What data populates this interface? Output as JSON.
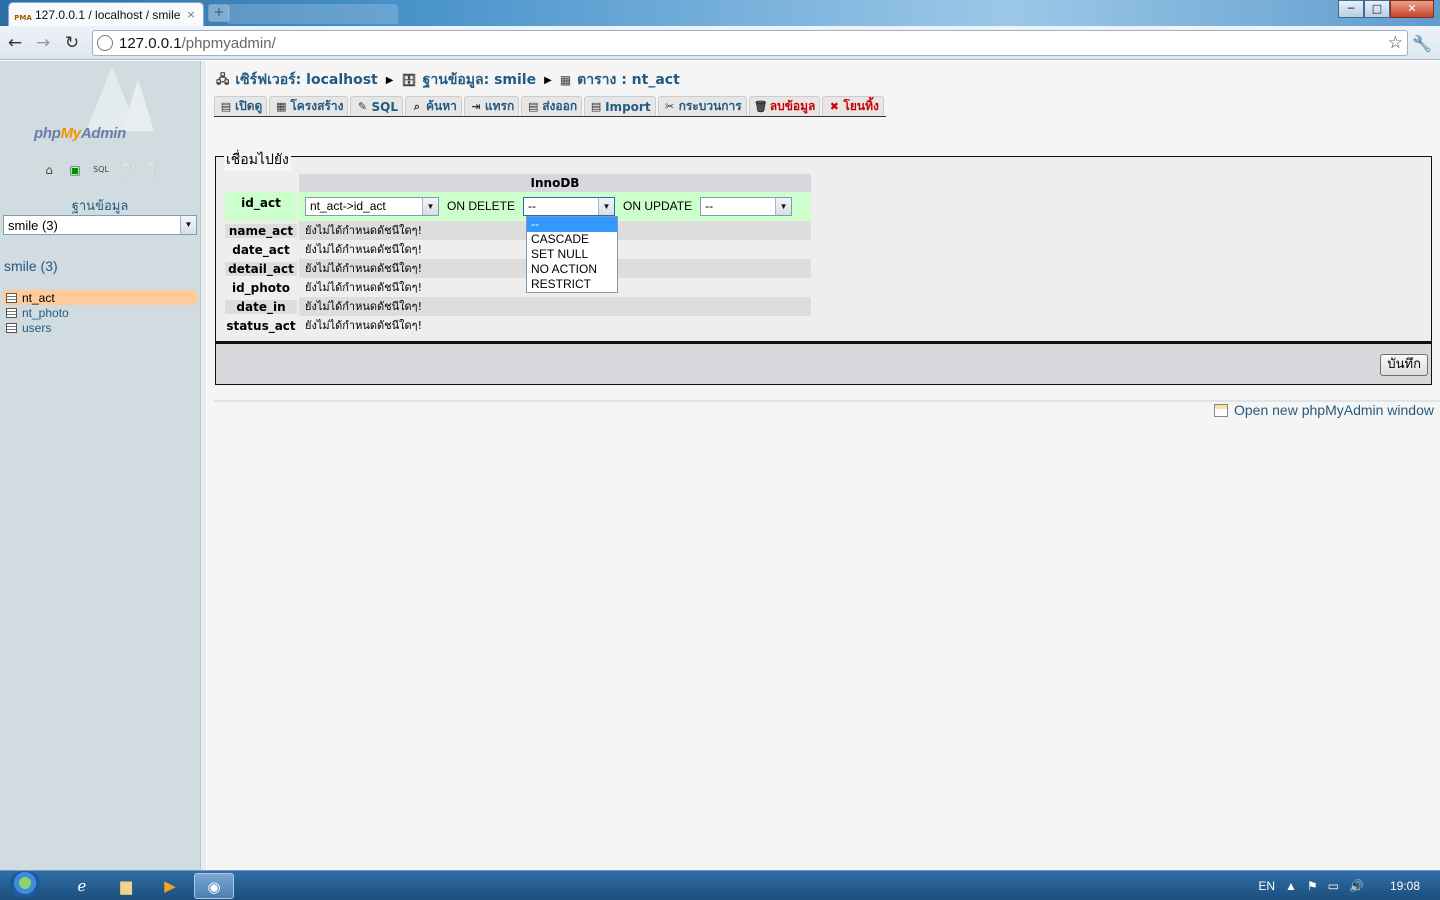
{
  "browser": {
    "tab_title": "127.0.0.1 / localhost / smile",
    "tab_favicon_text": "PMA",
    "url_host": "127.0.0.1",
    "url_path": "/phpmyadmin/"
  },
  "window_controls": {
    "minimize": "─",
    "maximize": "□",
    "close": "✕"
  },
  "sidebar": {
    "logo_php": "php",
    "logo_my": "My",
    "logo_admin": "Admin",
    "db_label": "ฐานข้อมูล",
    "db_select_value": "smile (3)",
    "db_heading": "smile (3)",
    "tables": [
      {
        "name": "nt_act",
        "active": true
      },
      {
        "name": "nt_photo",
        "active": false
      },
      {
        "name": "users",
        "active": false
      }
    ]
  },
  "breadcrumb": {
    "server": "เซิร์ฟเวอร์: localhost",
    "database": "ฐานข้อมูล: smile",
    "table": "ตาราง : nt_act"
  },
  "menu_tabs": [
    {
      "label": "เปิดดู",
      "icon": "browse-icon",
      "danger": false
    },
    {
      "label": "โครงสร้าง",
      "icon": "structure-icon",
      "danger": false
    },
    {
      "label": "SQL",
      "icon": "sql-icon",
      "danger": false
    },
    {
      "label": "ค้นหา",
      "icon": "search-icon",
      "danger": false
    },
    {
      "label": "แทรก",
      "icon": "insert-icon",
      "danger": false
    },
    {
      "label": "ส่งออก",
      "icon": "export-icon",
      "danger": false
    },
    {
      "label": "Import",
      "icon": "import-icon",
      "danger": false
    },
    {
      "label": "กระบวนการ",
      "icon": "operations-icon",
      "danger": false
    },
    {
      "label": "ลบข้อมูล",
      "icon": "empty-icon",
      "danger": true
    },
    {
      "label": "โยนทิ้ง",
      "icon": "drop-icon",
      "danger": true
    }
  ],
  "relation": {
    "legend": "เชื่อมไปยัง",
    "engine": "InnoDB",
    "first_row": {
      "field": "id_act",
      "foreign_value": "nt_act->id_act",
      "on_delete_label": "ON DELETE",
      "on_delete_value": "--",
      "on_update_label": "ON UPDATE",
      "on_update_value": "--"
    },
    "rows": [
      {
        "field": "name_act",
        "value": "ยังไม่ได้กำหนดดัชนีใดๆ!"
      },
      {
        "field": "date_act",
        "value": "ยังไม่ได้กำหนดดัชนีใดๆ!"
      },
      {
        "field": "detail_act",
        "value": "ยังไม่ได้กำหนดดัชนีใดๆ!"
      },
      {
        "field": "id_photo",
        "value": "ยังไม่ได้กำหนดดัชนีใดๆ!"
      },
      {
        "field": "date_in",
        "value": "ยังไม่ได้กำหนดดัชนีใดๆ!"
      },
      {
        "field": "status_act",
        "value": "ยังไม่ได้กำหนดดัชนีใดๆ!"
      }
    ],
    "on_delete_options": [
      "--",
      "CASCADE",
      "SET NULL",
      "NO ACTION",
      "RESTRICT"
    ],
    "save_label": "บันทึก"
  },
  "new_window_link": "Open new phpMyAdmin window",
  "taskbar": {
    "language": "EN",
    "clock": "19:08"
  }
}
